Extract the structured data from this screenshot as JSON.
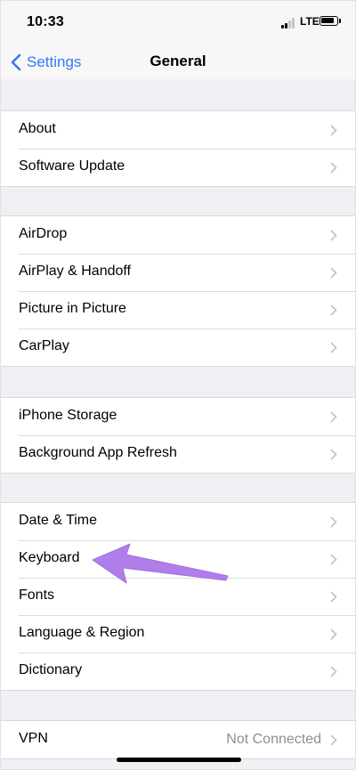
{
  "status_bar": {
    "time": "10:33",
    "network": "LTE"
  },
  "nav": {
    "back_label": "Settings",
    "title": "General"
  },
  "groups": [
    {
      "items": [
        {
          "label": "About"
        },
        {
          "label": "Software Update"
        }
      ]
    },
    {
      "items": [
        {
          "label": "AirDrop"
        },
        {
          "label": "AirPlay & Handoff"
        },
        {
          "label": "Picture in Picture"
        },
        {
          "label": "CarPlay"
        }
      ]
    },
    {
      "items": [
        {
          "label": "iPhone Storage"
        },
        {
          "label": "Background App Refresh"
        }
      ]
    },
    {
      "items": [
        {
          "label": "Date & Time"
        },
        {
          "label": "Keyboard"
        },
        {
          "label": "Fonts"
        },
        {
          "label": "Language & Region"
        },
        {
          "label": "Dictionary"
        }
      ]
    },
    {
      "items": [
        {
          "label": "VPN",
          "value": "Not Connected"
        }
      ]
    }
  ],
  "colors": {
    "accent": "#3478f6",
    "annotation_arrow": "#b07ee8",
    "background": "#efeff4",
    "secondary_text": "#8e8e93"
  },
  "annotation": {
    "arrow_target": "Keyboard"
  }
}
